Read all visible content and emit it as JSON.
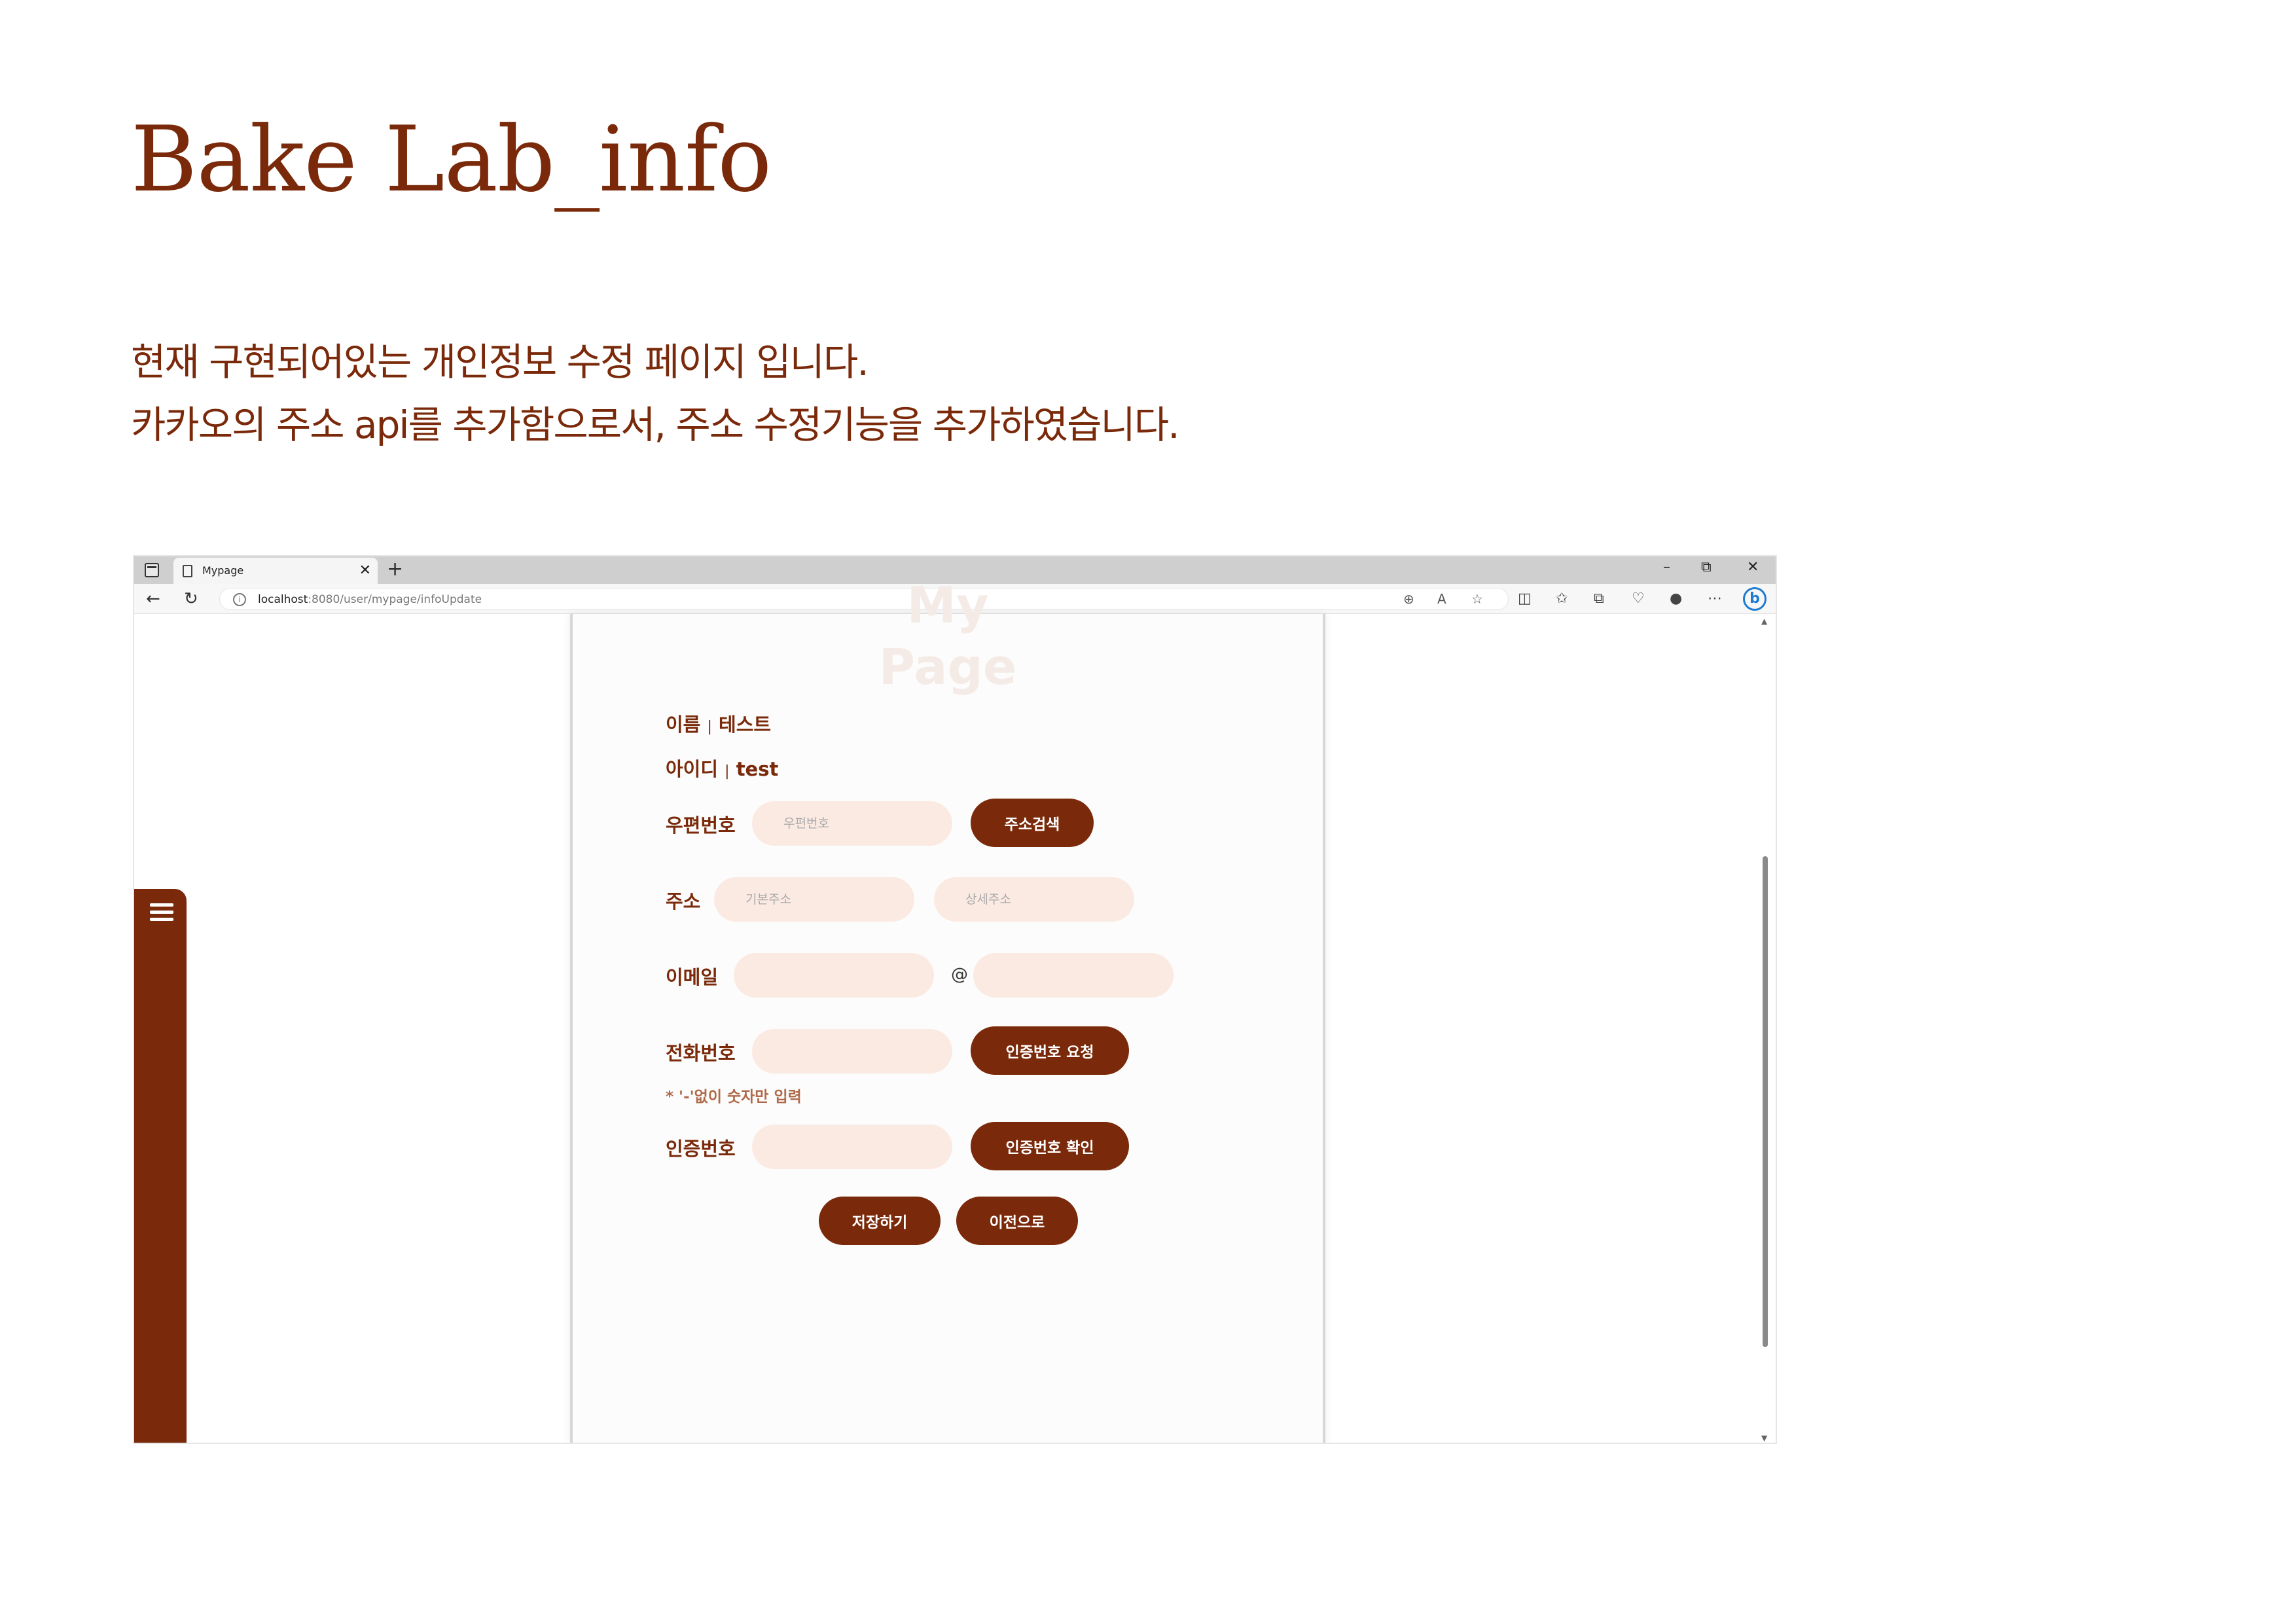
{
  "doc": {
    "title": "Bake Lab_info",
    "desc_line1": "현재 구현되어있는 개인정보 수정 페이지 입니다.",
    "desc_line2": "카카오의 주소 api를 추가함으로서, 주소 수정기능을 추가하였습니다."
  },
  "browser": {
    "tab_title": "Mypage",
    "tab_close": "✕",
    "new_tab": "+",
    "minimize": "–",
    "restore": "⧉",
    "close": "✕",
    "url_host": "localhost",
    "url_rest": ":8080/user/mypage/infoUpdate",
    "copilot": "b"
  },
  "page": {
    "ghost_title_top": "My",
    "ghost_title": "Page",
    "name_label": "이름",
    "name_value": "테스트",
    "id_label": "아이디",
    "id_value": "test",
    "separator": "|",
    "zip_label": "우편번호",
    "zip_placeholder": "우편번호",
    "zip_search_button": "주소검색",
    "address_label": "주소",
    "address_base_placeholder": "기본주소",
    "address_detail_placeholder": "상세주소",
    "email_label": "이메일",
    "email_at": "@",
    "phone_label": "전화번호",
    "phone_request_button": "인증번호 요청",
    "phone_hint": "* '-'없이 숫자만 입력",
    "verify_label": "인증번호",
    "verify_confirm_button": "인증번호 확인",
    "save_button": "저장하기",
    "back_button": "이전으로"
  },
  "colors": {
    "brand": "#7a2a0a",
    "field_bg": "#fbeae2"
  }
}
